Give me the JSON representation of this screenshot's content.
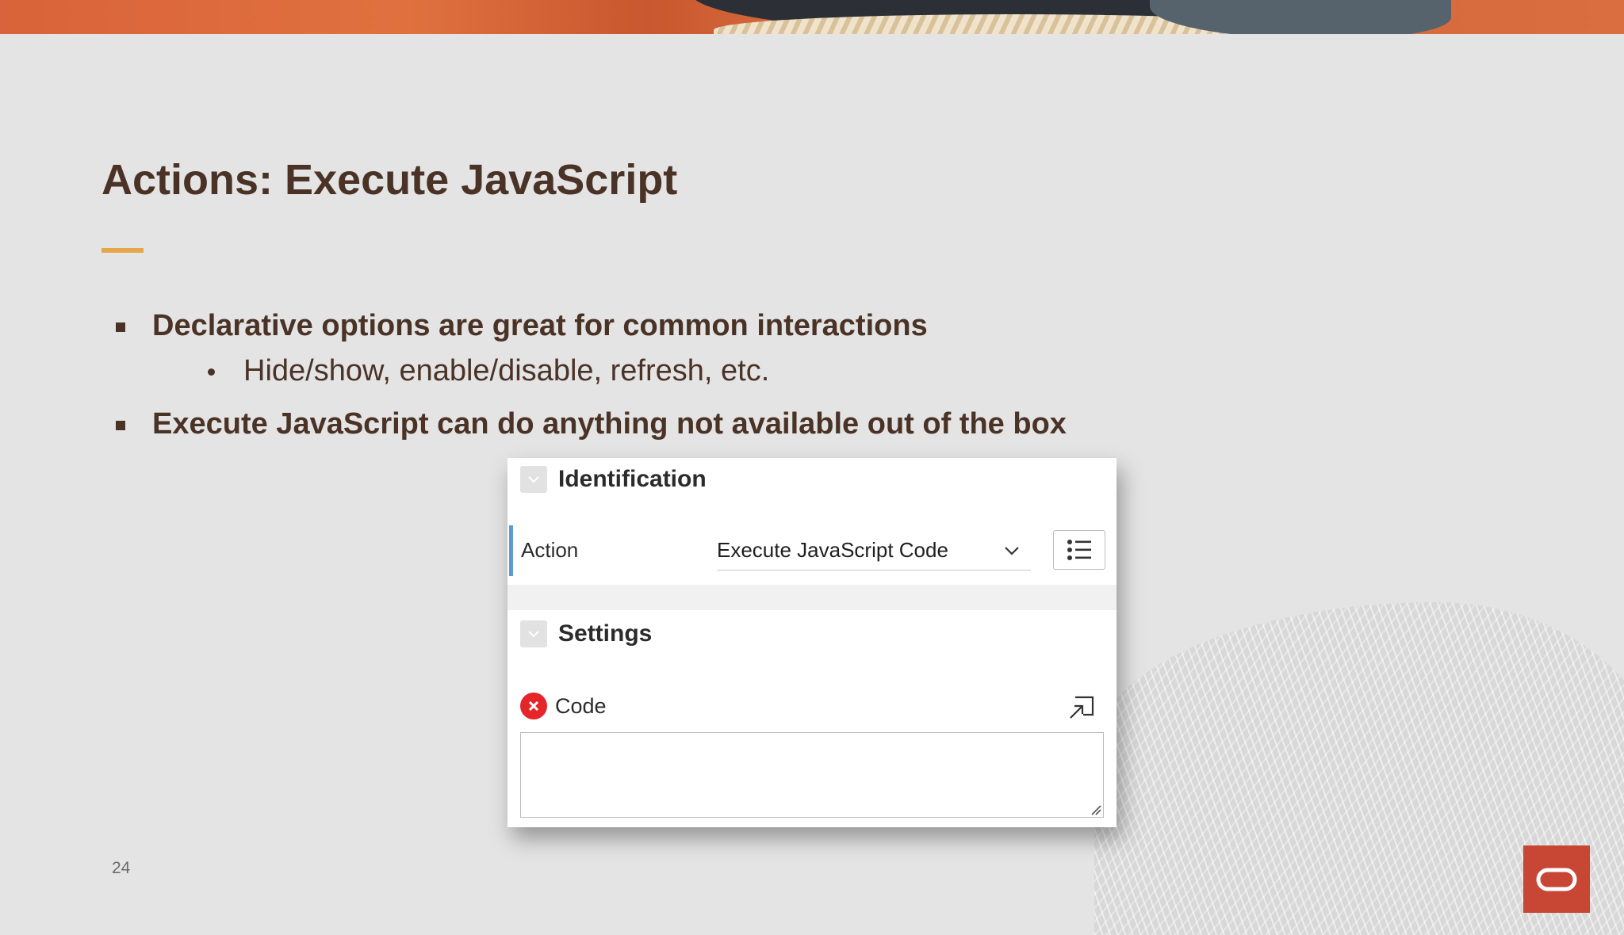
{
  "slide": {
    "title": "Actions: Execute JavaScript",
    "page_number": "24",
    "bullets": [
      {
        "text": "Declarative options are great for common interactions"
      },
      {
        "text": "Hide/show, enable/disable, refresh, etc."
      },
      {
        "text": "Execute JavaScript can do anything not available out of the box"
      }
    ]
  },
  "panel": {
    "identification": {
      "title": "Identification",
      "action_label": "Action",
      "action_value": "Execute JavaScript Code"
    },
    "settings": {
      "title": "Settings",
      "code_label": "Code",
      "code_value": ""
    }
  },
  "icons": [
    "collapse-chevron-icon",
    "chevron-down-icon",
    "list-icon",
    "error-icon",
    "expand-icon",
    "resize-grip-icon",
    "oracle-logo-icon"
  ],
  "colors": {
    "title": "#4a3326",
    "accent": "#e6a64a",
    "error": "#e5252a",
    "oracle_red": "#c74634",
    "focus_bar": "#5d99d6"
  }
}
